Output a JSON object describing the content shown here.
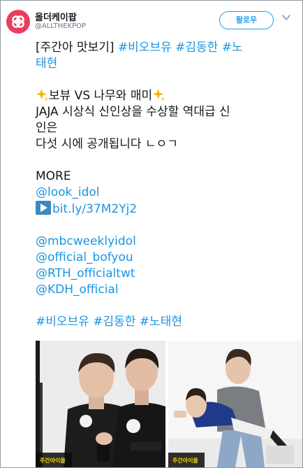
{
  "header": {
    "display_name": "올더케이팝",
    "handle": "@ALLTHEKPOP",
    "follow_label": "팔로우"
  },
  "tweet": {
    "line1_prefix": "[주간아 맛보기] ",
    "line1_hashtags": [
      "#비오브유",
      "#김동한",
      "#노"
    ],
    "line2_hashtag": "태현",
    "line3_text": "보뷰 VS 나무와 매미",
    "line4": "JAJA 시상식 신인상을 수상할 역대급 신",
    "line5": "인은",
    "line6": "다섯 시에 공개됩니다 ㄴㅇㄱ",
    "more": "MORE",
    "link_look_idol": "@look_idol",
    "link_bitly": "bit.ly/37M2Yj2",
    "mentions": [
      "@mbcweeklyidol",
      "@official_bofyou",
      "@RTH_officialtwt",
      "@KDH_official"
    ],
    "final_hashtags": [
      "#비오브유",
      "#김동한",
      "#노태현"
    ]
  },
  "media": {
    "photo1_caption": "주간아이돌",
    "photo2_caption": "주간아이돌"
  },
  "colors": {
    "link": "#1b95e0",
    "follow": "#1da1f2",
    "avatar": "#ea3e5f",
    "text": "#14171a",
    "muted": "#657786"
  },
  "icons": {
    "avatar": "brand-logo-icon",
    "menu": "chevron-down-icon",
    "sparkle": "sparkles-icon",
    "play": "play-button-icon"
  }
}
